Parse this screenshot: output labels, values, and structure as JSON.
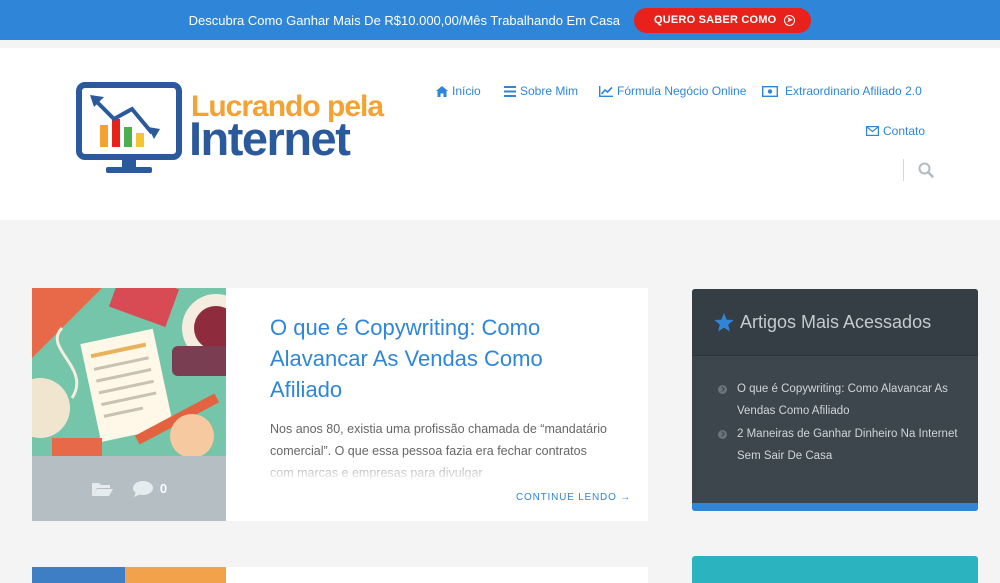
{
  "topbar": {
    "text": "Descubra Como Ganhar Mais De R$10.000,00/Mês Trabalhando Em Casa",
    "button_label": "QUERO SABER COMO"
  },
  "logo": {
    "line1": "Lucrando pela",
    "line2": "Internet"
  },
  "nav": {
    "items": [
      {
        "label": "Início",
        "icon": "home-icon"
      },
      {
        "label": "Sobre Mim",
        "icon": "list-icon"
      },
      {
        "label": "Fórmula Negócio Online",
        "icon": "chart-line-icon"
      },
      {
        "label": "Extraordinario Afiliado 2.0",
        "icon": "money-icon"
      },
      {
        "label": "Contato",
        "icon": "envelope-icon"
      }
    ]
  },
  "post": {
    "title": "O que é Copywriting: Como Alavancar As Vendas Como Afiliado",
    "excerpt": "Nos anos 80, existia uma profissão chamada de “mandatário comercial”. O que essa pessoa fazia era fechar contratos com marcas e empresas para divulgar",
    "comments": "0",
    "more": "CONTINUE LENDO →"
  },
  "widget": {
    "title": "Artigos Mais Acessados",
    "items": [
      "O que é Copywriting: Como Alavancar As Vendas Como Afiliado",
      "2 Maneiras de Ganhar Dinheiro Na Internet Sem Sair De Casa"
    ]
  },
  "colors": {
    "accent": "#2f86d8",
    "cta": "#e8211b",
    "logo_orange": "#f4a233",
    "logo_blue": "#2a5a9c",
    "widget_bg": "#3c464c",
    "widget2_bg": "#2bb3c0"
  }
}
